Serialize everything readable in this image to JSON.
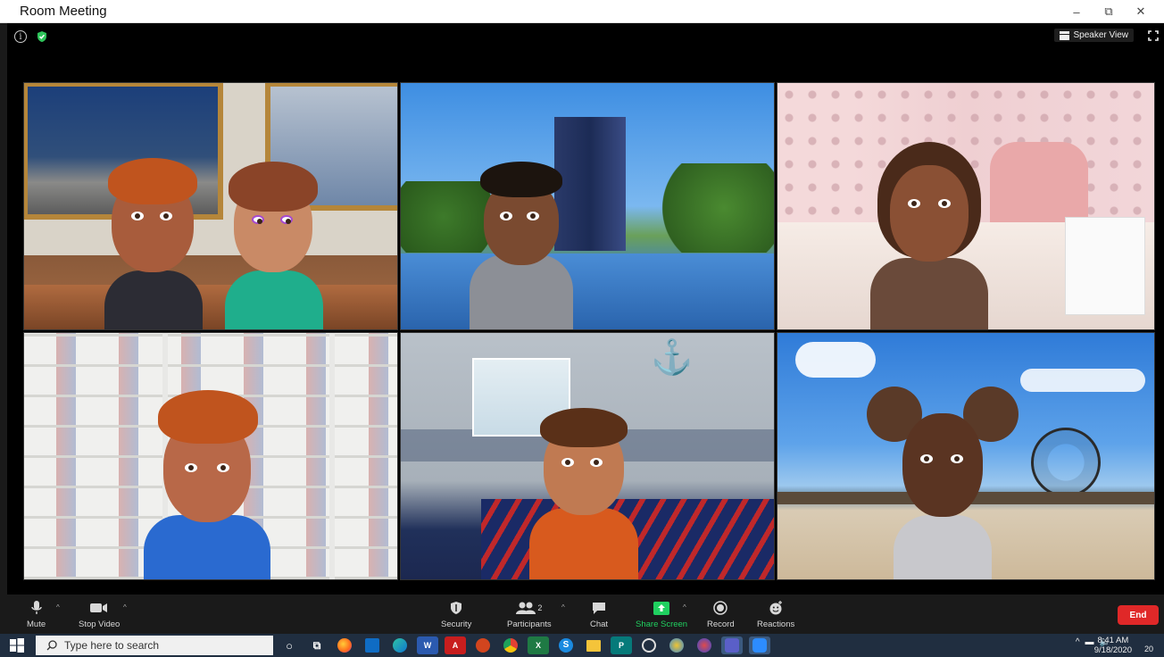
{
  "window": {
    "title": "Room Meeting",
    "minimize": "–",
    "restore": "⧉",
    "close": "✕"
  },
  "meeting": {
    "speaker_view_label": "Speaker View",
    "participants": [
      {
        "tile": 1,
        "scene": "space-themed bedroom with framed Earth and astronaut pictures",
        "avatars": 2
      },
      {
        "tile": 2,
        "scene": "office tower and reflecting pool",
        "avatars": 1
      },
      {
        "tile": 3,
        "scene": "pink polka-dot bedroom",
        "avatars": 1
      },
      {
        "tile": 4,
        "scene": "wall of sneaker shelves",
        "avatars": 1
      },
      {
        "tile": 5,
        "scene": "nautical-themed bedroom",
        "avatars": 1
      },
      {
        "tile": 6,
        "scene": "beach with pier and ferris wheel",
        "avatars": 1
      }
    ]
  },
  "controls": {
    "mute": "Mute",
    "stop_video": "Stop Video",
    "security": "Security",
    "participants": "Participants",
    "participants_count": "2",
    "chat": "Chat",
    "share_screen": "Share Screen",
    "record": "Record",
    "reactions": "Reactions",
    "end": "End"
  },
  "taskbar": {
    "search_placeholder": "Type here to search",
    "time": "8:41 AM",
    "date": "9/18/2020",
    "notification_count": "20",
    "apps": [
      "task-view",
      "firefox",
      "outlook",
      "edge",
      "word",
      "acrobat",
      "powerpoint",
      "chrome",
      "excel",
      "skype",
      "file-explorer",
      "publisher",
      "obs",
      "app",
      "app",
      "teams",
      "zoom"
    ]
  },
  "colors": {
    "end_button": "#e02828",
    "share_screen_green": "#20d060",
    "taskbar": "#202e40",
    "shield_green": "#2ec45a"
  }
}
